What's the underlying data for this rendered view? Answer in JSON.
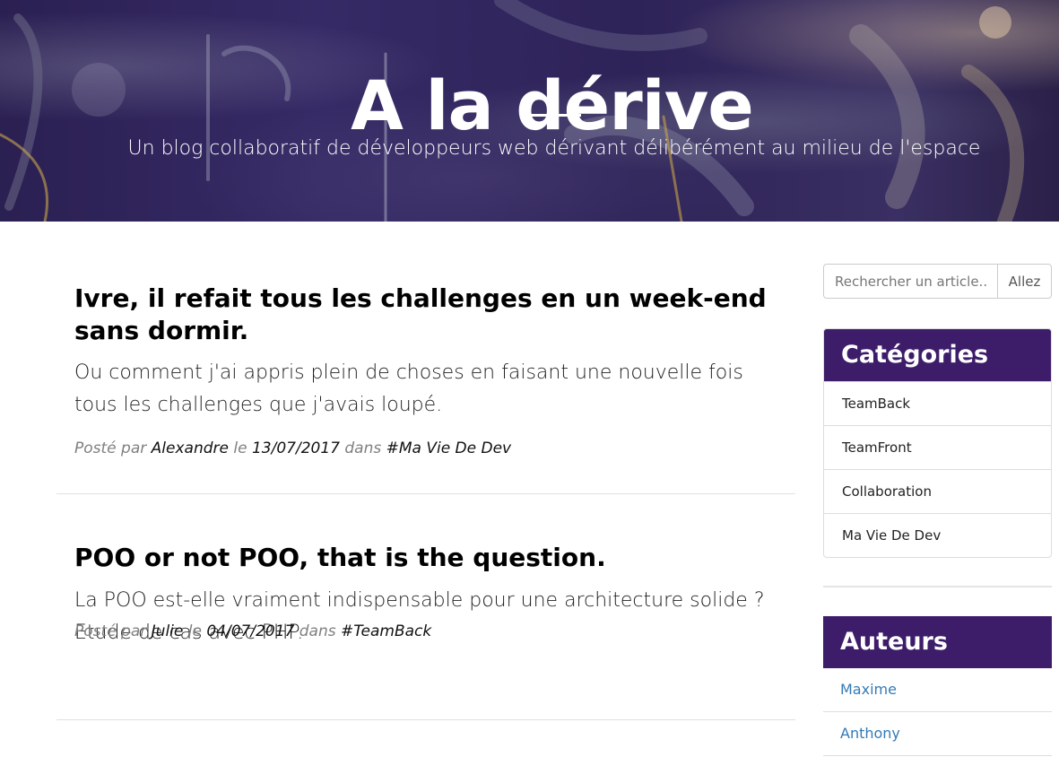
{
  "header": {
    "title": "A la dérive",
    "subtitle": "Un blog collaboratif de développeurs web dérivant délibérément au milieu de l'espace"
  },
  "posts": [
    {
      "title": "Ivre, il refait tous les challenges en un week-end sans dormir.",
      "excerpt": "Ou comment j'ai appris plein de choses en faisant une nouvelle fois tous les challenges que j'avais loupé.",
      "meta": {
        "posted_by_label": "Posté par",
        "author": "Alexandre",
        "date_label": "le",
        "date": "13/07/2017",
        "in_label": "dans",
        "category": "#Ma Vie De Dev"
      }
    },
    {
      "title": "POO or not POO, that is the question.",
      "excerpt": "La POO est-elle vraiment indispensable pour une architecture solide ? Etude de cas avec PHP.",
      "meta": {
        "posted_by_label": "Posté par",
        "author": "Julie",
        "date_label": "le",
        "date": "04/07/2017",
        "in_label": "dans",
        "category": "#TeamBack"
      }
    }
  ],
  "search": {
    "placeholder": "Rechercher un article...",
    "button_label": "Allez"
  },
  "categories": {
    "heading": "Catégories",
    "items": [
      "TeamBack",
      "TeamFront",
      "Collaboration",
      "Ma Vie De Dev"
    ]
  },
  "authors": {
    "heading": "Auteurs",
    "items": [
      "Maxime",
      "Anthony"
    ]
  },
  "colors": {
    "panel_header": "#3d1c6a",
    "link": "#337ab7",
    "meta_grey": "#808080"
  }
}
